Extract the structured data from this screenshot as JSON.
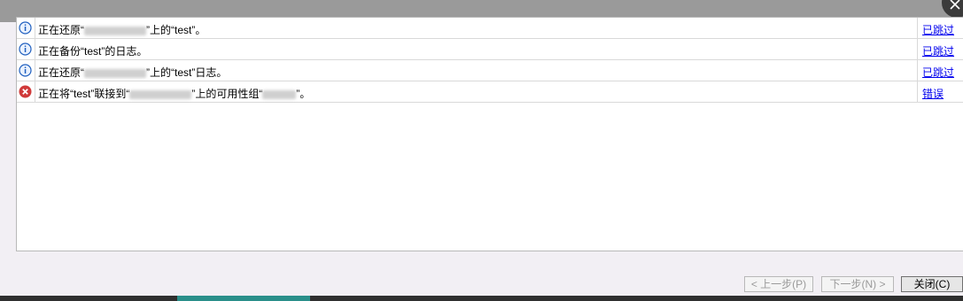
{
  "rows": [
    {
      "type": "info",
      "before": "正在还原“",
      "after": "”上的“test”。",
      "status": "已跳过"
    },
    {
      "type": "info",
      "text": "正在备份“test”的日志。",
      "status": "已跳过"
    },
    {
      "type": "info",
      "before": "正在还原“",
      "after": "”上的“test”日志。",
      "status": "已跳过"
    },
    {
      "type": "error",
      "before": "正在将“test”联接到“",
      "middle": "”上的可用性组“",
      "after": "”。",
      "status": "错误"
    }
  ],
  "buttons": {
    "prev": "< 上一步(P)",
    "next": "下一步(N) >",
    "close": "关闭(C)"
  },
  "colors": {
    "link": "#0000ee",
    "info_icon": "#1f5fbf",
    "error_icon": "#d03a3a"
  }
}
